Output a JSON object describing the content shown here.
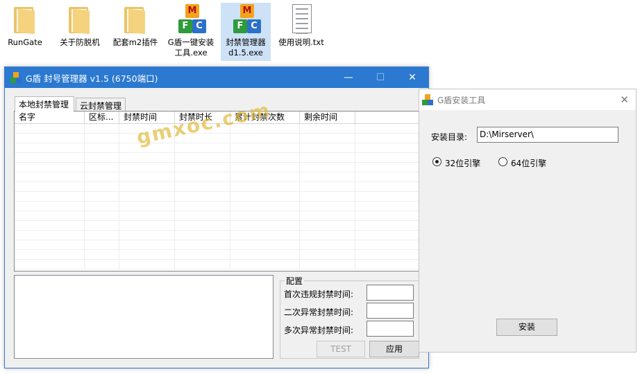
{
  "desktop": {
    "icons": [
      {
        "label": "RunGate",
        "icon": "folder-icon"
      },
      {
        "label": "关于防脱机",
        "icon": "folder-icon"
      },
      {
        "label": "配套m2插件",
        "icon": "folder-icon"
      },
      {
        "label": "G盾一键安装工具.exe",
        "icon": "mfc-app-icon"
      },
      {
        "label": "封禁管理器d1.5.exe",
        "icon": "mfc-app-icon"
      },
      {
        "label": "使用说明.txt",
        "icon": "text-file-icon"
      }
    ]
  },
  "main_window": {
    "title": "G盾 封号管理器 v1.5 (6750端口)",
    "controls": {
      "minimize": "—",
      "maximize": "☐",
      "close": "✕"
    },
    "tabs": [
      {
        "label": "本地封禁管理",
        "active": true
      },
      {
        "label": "云封禁管理",
        "active": false
      }
    ],
    "list_columns": [
      "名字",
      "区标...",
      "封禁时间",
      "封禁时长",
      "累计封禁次数",
      "剩余时间"
    ],
    "config": {
      "legend": "配置",
      "fields": [
        {
          "label": "首次违规封禁时间:",
          "value": ""
        },
        {
          "label": "二次异常封禁时间:",
          "value": ""
        },
        {
          "label": "多次异常封禁时间:",
          "value": ""
        }
      ],
      "test_button": "TEST",
      "apply_button": "应用"
    }
  },
  "watermark": "gmxoc.com",
  "installer_window": {
    "title": "G盾安装工具",
    "close": "✕",
    "dir_label": "安装目录:",
    "dir_value": "D:\\Mirserver\\",
    "radio_32": "32位引擎",
    "radio_64": "64位引擎",
    "selected_engine": "32",
    "install_button": "安装"
  },
  "colors": {
    "titlebar_active": "#2b79d0",
    "window_bg": "#f0f0f0",
    "selection": "#cde2f7"
  }
}
